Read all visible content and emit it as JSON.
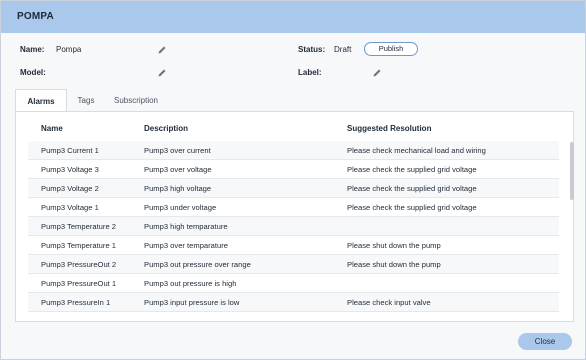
{
  "window": {
    "title": "POMPA"
  },
  "fields": {
    "name_label": "Name:",
    "name_value": "Pompa",
    "model_label": "Model:",
    "model_value": "",
    "status_label": "Status:",
    "status_value": "Draft",
    "publish_label": "Publish",
    "label_label": "Label:",
    "label_value": ""
  },
  "tabs": [
    {
      "label": "Alarms",
      "active": true
    },
    {
      "label": "Tags",
      "active": false
    },
    {
      "label": "Subscription",
      "active": false
    }
  ],
  "table": {
    "headers": [
      "Name",
      "Description",
      "Suggested Resolution"
    ],
    "rows": [
      [
        "Pump3 Current 1",
        "Pump3 over current",
        "Please check mechanical load and wiring"
      ],
      [
        "Pump3 Voltage 3",
        "Pump3 over voltage",
        "Please check the supplied grid voltage"
      ],
      [
        "Pump3 Voltage 2",
        "Pump3 high voltage",
        "Please check the supplied grid voltage"
      ],
      [
        "Pump3 Voltage 1",
        "Pump3 under voltage",
        "Please check the supplied grid voltage"
      ],
      [
        "Pump3 Temperature 2",
        "Pump3 high temparature",
        ""
      ],
      [
        "Pump3 Temperature 1",
        "Pump3 over temparature",
        "Please shut down the pump"
      ],
      [
        "Pump3 PressureOut 2",
        "Pump3 out pressure over range",
        "Please shut down the pump"
      ],
      [
        "Pump3 PressureOut 1",
        "Pump3 out pressure is high",
        ""
      ],
      [
        "Pump3 PressureIn 1",
        "Pump3 input pressure is low",
        "Please check input valve"
      ]
    ]
  },
  "footer": {
    "close_label": "Close"
  },
  "icons": {
    "edit": "pencil-icon"
  },
  "colors": {
    "accent": "#a9c8ec",
    "publish_border": "#6e99cf"
  }
}
